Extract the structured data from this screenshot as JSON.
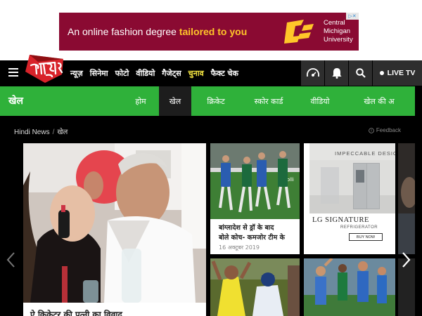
{
  "ad": {
    "text_plain": "An online fashion degree ",
    "text_highlight": "tailored to you",
    "university_line1": "Central",
    "university_line2": "Michigan",
    "university_line3": "University",
    "colors": {
      "background": "#8a0a32",
      "highlight": "#ffc629"
    }
  },
  "header": {
    "logo_text": "आज तक",
    "nav": [
      "न्यूज़",
      "सिनेमा",
      "फोटो",
      "वीडियो",
      "गैजेट्स",
      "चुनाव",
      "फैक्ट चेक"
    ],
    "highlight_nav": "चुनाव",
    "live_tv": "LIVE TV",
    "icons": [
      "audio-icon",
      "bell-icon",
      "search-icon"
    ]
  },
  "subnav": {
    "title": "खेल",
    "items": [
      "होम",
      "खेल",
      "क्रिकेट",
      "स्कोर कार्ड",
      "वीडियो",
      "खेल की अ"
    ],
    "active": "खेल",
    "color": "#2fb13a"
  },
  "breadcrumb": {
    "home": "Hindi News",
    "current": "खेल",
    "feedback": "Feedback"
  },
  "stories": {
    "main_caption": "ऐ क्रिकेटर की पत्नी का विवाद",
    "card1_title_line1": "बांग्लादेश से ड्रॉ के बाद",
    "card1_title_line2": "बोले कोच- कमजोर टीम के",
    "card1_date": "16 अक्टूबर 2019",
    "promo_heading": "IMPECCABLE DESIG",
    "promo_brand": "LG SIGNATURE",
    "promo_product": "REFRIGERATOR",
    "promo_cta": "BUY NOW"
  }
}
